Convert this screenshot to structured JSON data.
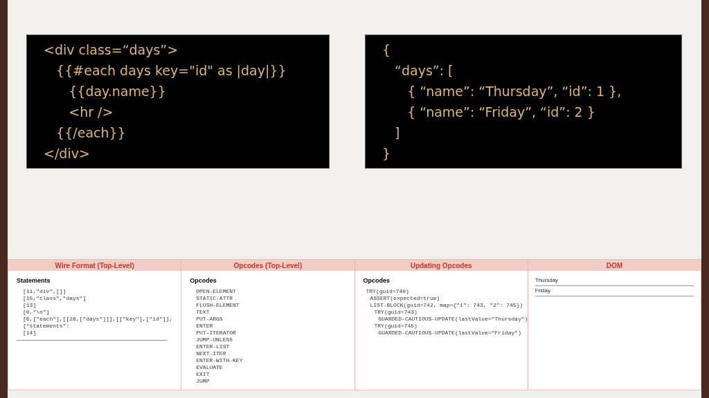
{
  "template_code": {
    "lines": [
      "<div class=“days”>",
      "   {{#each days key=\"id\" as |day|}}",
      "      {{day.name}}",
      "      <hr />",
      "   {{/each}}",
      "</div>"
    ]
  },
  "data_code": {
    "lines": [
      "{",
      "   “days”: [",
      "      { “name”: “Thursday”, “id”: 1 },",
      "      { “name”: “Friday”, “id”: 2 }",
      "   ]",
      "}"
    ]
  },
  "panels": [
    {
      "kind": "code",
      "title": "Wire Format (Top-Level)",
      "heading": "Statements",
      "rule": true,
      "lines": [
        "[11,\"div\",[]]",
        "[15,\"class\",\"days\"]",
        "[13]",
        "[0,\"\\n\"]",
        "[6,[\"each\"],[[28,[\"days\"]]],[[\"key\"],[\"id\"]],{\"statements\":",
        "[14]"
      ]
    },
    {
      "kind": "code",
      "title": "Opcodes (Top-Level)",
      "heading": "Opcodes",
      "rule": false,
      "lines": [
        "OPEN-ELEMENT",
        "STATIC-ATTR",
        "FLUSH-ELEMENT",
        "TEXT",
        "PUT-ARGS",
        "ENTER",
        "PUT-ITERATOR",
        "JUMP-UNLESS",
        "ENTER-LIST",
        "NEXT-ITER",
        "ENTER-WITH-KEY",
        "EVALUATE",
        "EXIT",
        "JUMP"
      ]
    },
    {
      "kind": "tree",
      "title": "Updating Opcodes",
      "heading": "Opcodes",
      "items": [
        {
          "text": "TRY(guid=740)",
          "children": [
            {
              "text": "ASSERT(expected=true)"
            },
            {
              "text": "LIST-BLOCK(guid=742, map={\"1\": 743, \"2\": 745})",
              "children": [
                {
                  "text": "TRY(guid=743)",
                  "children": [
                    {
                      "text": "GUARDED-CAUTIOUS-UPDATE(lastValue=\"Thursday\")"
                    }
                  ]
                },
                {
                  "text": "TRY(guid=745)",
                  "children": [
                    {
                      "text": "GUARDED-CAUTIOUS-UPDATE(lastValue=\"Friday\")"
                    }
                  ]
                }
              ]
            }
          ]
        }
      ]
    },
    {
      "kind": "dom",
      "title": "DOM",
      "items": [
        "Thursday",
        "Friday"
      ]
    }
  ]
}
